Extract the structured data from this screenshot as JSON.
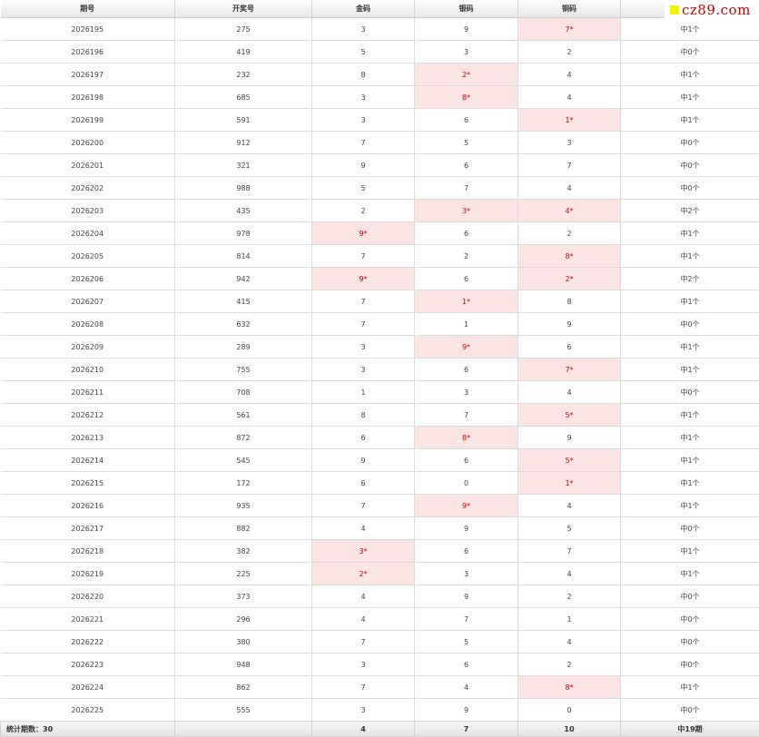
{
  "header": {
    "period": "期号",
    "draw_number": "开奖号",
    "gold": "金码",
    "silver": "银码",
    "bronze": "铜码",
    "result": ""
  },
  "watermark": "cz89.com",
  "rows": [
    {
      "period": "2026195",
      "draw": "275",
      "gold": "3",
      "silver": "9",
      "bronze": "7*",
      "result": "中1个",
      "hit": "bronze"
    },
    {
      "period": "2026196",
      "draw": "419",
      "gold": "5",
      "silver": "3",
      "bronze": "2",
      "result": "中0个",
      "hit": ""
    },
    {
      "period": "2026197",
      "draw": "232",
      "gold": "8",
      "silver": "2*",
      "bronze": "4",
      "result": "中1个",
      "hit": "silver"
    },
    {
      "period": "2026198",
      "draw": "685",
      "gold": "3",
      "silver": "8*",
      "bronze": "4",
      "result": "中1个",
      "hit": "silver"
    },
    {
      "period": "2026199",
      "draw": "591",
      "gold": "3",
      "silver": "6",
      "bronze": "1*",
      "result": "中1个",
      "hit": "bronze"
    },
    {
      "period": "2026200",
      "draw": "912",
      "gold": "7",
      "silver": "5",
      "bronze": "3",
      "result": "中0个",
      "hit": ""
    },
    {
      "period": "2026201",
      "draw": "321",
      "gold": "9",
      "silver": "6",
      "bronze": "7",
      "result": "中0个",
      "hit": ""
    },
    {
      "period": "2026202",
      "draw": "988",
      "gold": "5",
      "silver": "7",
      "bronze": "4",
      "result": "中0个",
      "hit": ""
    },
    {
      "period": "2026203",
      "draw": "435",
      "gold": "2",
      "silver": "3*",
      "bronze": "4*",
      "result": "中2个",
      "hit": "silver,bronze"
    },
    {
      "period": "2026204",
      "draw": "978",
      "gold": "9*",
      "silver": "6",
      "bronze": "2",
      "result": "中1个",
      "hit": "gold"
    },
    {
      "period": "2026205",
      "draw": "814",
      "gold": "7",
      "silver": "2",
      "bronze": "8*",
      "result": "中1个",
      "hit": "bronze"
    },
    {
      "period": "2026206",
      "draw": "942",
      "gold": "9*",
      "silver": "6",
      "bronze": "2*",
      "result": "中2个",
      "hit": "gold,bronze"
    },
    {
      "period": "2026207",
      "draw": "415",
      "gold": "7",
      "silver": "1*",
      "bronze": "8",
      "result": "中1个",
      "hit": "silver"
    },
    {
      "period": "2026208",
      "draw": "632",
      "gold": "7",
      "silver": "1",
      "bronze": "9",
      "result": "中0个",
      "hit": ""
    },
    {
      "period": "2026209",
      "draw": "289",
      "gold": "3",
      "silver": "9*",
      "bronze": "6",
      "result": "中1个",
      "hit": "silver"
    },
    {
      "period": "2026210",
      "draw": "755",
      "gold": "3",
      "silver": "6",
      "bronze": "7*",
      "result": "中1个",
      "hit": "bronze"
    },
    {
      "period": "2026211",
      "draw": "708",
      "gold": "1",
      "silver": "3",
      "bronze": "4",
      "result": "中0个",
      "hit": ""
    },
    {
      "period": "2026212",
      "draw": "561",
      "gold": "8",
      "silver": "7",
      "bronze": "5*",
      "result": "中1个",
      "hit": "bronze"
    },
    {
      "period": "2026213",
      "draw": "872",
      "gold": "6",
      "silver": "8*",
      "bronze": "9",
      "result": "中1个",
      "hit": "silver"
    },
    {
      "period": "2026214",
      "draw": "545",
      "gold": "9",
      "silver": "6",
      "bronze": "5*",
      "result": "中1个",
      "hit": "bronze"
    },
    {
      "period": "2026215",
      "draw": "172",
      "gold": "6",
      "silver": "0",
      "bronze": "1*",
      "result": "中1个",
      "hit": "bronze"
    },
    {
      "period": "2026216",
      "draw": "935",
      "gold": "7",
      "silver": "9*",
      "bronze": "4",
      "result": "中1个",
      "hit": "silver"
    },
    {
      "period": "2026217",
      "draw": "882",
      "gold": "4",
      "silver": "9",
      "bronze": "5",
      "result": "中0个",
      "hit": ""
    },
    {
      "period": "2026218",
      "draw": "382",
      "gold": "3*",
      "silver": "6",
      "bronze": "7",
      "result": "中1个",
      "hit": "gold"
    },
    {
      "period": "2026219",
      "draw": "225",
      "gold": "2*",
      "silver": "3",
      "bronze": "4",
      "result": "中1个",
      "hit": "gold"
    },
    {
      "period": "2026220",
      "draw": "373",
      "gold": "4",
      "silver": "9",
      "bronze": "2",
      "result": "中0个",
      "hit": ""
    },
    {
      "period": "2026221",
      "draw": "296",
      "gold": "4",
      "silver": "7",
      "bronze": "1",
      "result": "中0个",
      "hit": ""
    },
    {
      "period": "2026222",
      "draw": "380",
      "gold": "7",
      "silver": "5",
      "bronze": "4",
      "result": "中0个",
      "hit": ""
    },
    {
      "period": "2026223",
      "draw": "948",
      "gold": "3",
      "silver": "6",
      "bronze": "2",
      "result": "中0个",
      "hit": ""
    },
    {
      "period": "2026224",
      "draw": "862",
      "gold": "7",
      "silver": "4",
      "bronze": "8*",
      "result": "中1个",
      "hit": "bronze"
    },
    {
      "period": "2026225",
      "draw": "555",
      "gold": "3",
      "silver": "9",
      "bronze": "0",
      "result": "中0个",
      "hit": ""
    }
  ],
  "footer": {
    "label": "统计期数：30",
    "draw": "",
    "gold": "4",
    "silver": "7",
    "bronze": "10",
    "result": "中19期"
  },
  "colors": {
    "hit_background": "#fae4e4",
    "hit_text": "#cc0000",
    "watermark_square": "#f5f500",
    "watermark_text": "#cc0000"
  }
}
